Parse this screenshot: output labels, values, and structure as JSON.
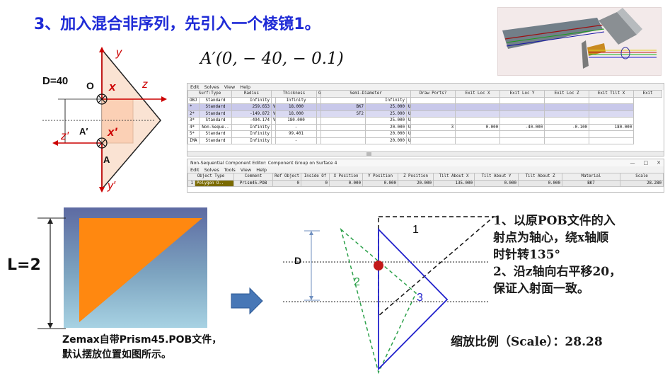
{
  "slide": {
    "title": "3、加入混合非序列，先引入一个棱镜1。",
    "formula": "A′(0, − 40, − 0.1)",
    "left_caption": [
      "Zemax自带Prism45.POB文件，",
      "默认摆放位置如图所示。"
    ],
    "L_label": "L=2",
    "notes": [
      "1、以原POB文件的入",
      "射点为轴心，绕x轴顺",
      "时针转135°",
      "2、沿z轴向右平移20，",
      "保证入射面一致。"
    ],
    "scale_text": "缩放比例（Scale）：28.28"
  },
  "axes_diagram": {
    "d_label": "D=40",
    "o_label": "O",
    "a_prime_label": "A′",
    "a_label": "A",
    "x_label": "x",
    "x_prime_label": "x′",
    "y_label": "y",
    "y_prime_label": "y′",
    "z_label": "z",
    "z_prime_label": "z′"
  },
  "rotation_diagram": {
    "d_label": "D",
    "label_1": "1",
    "label_2": "2",
    "label_3": "3"
  },
  "lens_editor": {
    "menu": [
      "Edit",
      "Solves",
      "View",
      "Help"
    ],
    "columns": [
      "Surf:Type",
      "Radius",
      "Thickness",
      "Glass",
      "Semi-Diameter",
      "Draw Ports?",
      "Exit Loc X",
      "Exit Loc Y",
      "Exit Loc Z",
      "Exit Tilt X",
      "Exit"
    ],
    "rows": [
      [
        "OBJ",
        "Standard",
        "Infinity",
        "",
        "Infinity",
        "",
        "",
        "Infinity",
        "",
        "",
        "",
        "",
        "",
        ""
      ],
      [
        "*",
        "Standard",
        "259.653",
        "V",
        "18.000",
        "",
        "BK7",
        "25.000",
        "U",
        "",
        "",
        "",
        "",
        ""
      ],
      [
        "2*",
        "Standard",
        "-149.872",
        "V",
        "18.000",
        "",
        "SF2",
        "25.000",
        "U",
        "",
        "",
        "",
        "",
        ""
      ],
      [
        "3*",
        "Standard",
        "-494.174",
        "V",
        "180.000",
        "",
        "",
        "25.000",
        "U",
        "",
        "",
        "",
        "",
        ""
      ],
      [
        "4*",
        "Non-Seque..",
        "Infinity",
        "",
        "-",
        "",
        "",
        "20.000",
        "U",
        "3",
        "0.000",
        "-40.000",
        "-0.100",
        "180.000"
      ],
      [
        "5*",
        "Standard",
        "Infinity",
        "",
        "99.401",
        "",
        "",
        "20.000",
        "U",
        "",
        "",
        "",
        "",
        ""
      ],
      [
        "IMA",
        "Standard",
        "Infinity",
        "",
        "-",
        "",
        "",
        "20.000",
        "U",
        "",
        "",
        "",
        "",
        ""
      ]
    ]
  },
  "nsc_editor": {
    "title": "Non-Sequential Component Editor: Component Group on Surface 4",
    "menu": [
      "Edit",
      "Solves",
      "Tools",
      "View",
      "Help"
    ],
    "window_controls": [
      "—",
      "□",
      "✕"
    ],
    "columns": [
      "Object Type",
      "Comment",
      "Ref Object",
      "Inside Of",
      "X Position",
      "Y Position",
      "Z Position",
      "Tilt About X",
      "Tilt About Y",
      "Tilt About Z",
      "Material",
      "Scale"
    ],
    "row": [
      "1",
      "Polygon O..",
      "Prism45.POB",
      "0",
      "0",
      "0.000",
      "0.000",
      "20.000",
      "135.000",
      "0.000",
      "0.000",
      "BK7",
      "28.280"
    ]
  }
}
